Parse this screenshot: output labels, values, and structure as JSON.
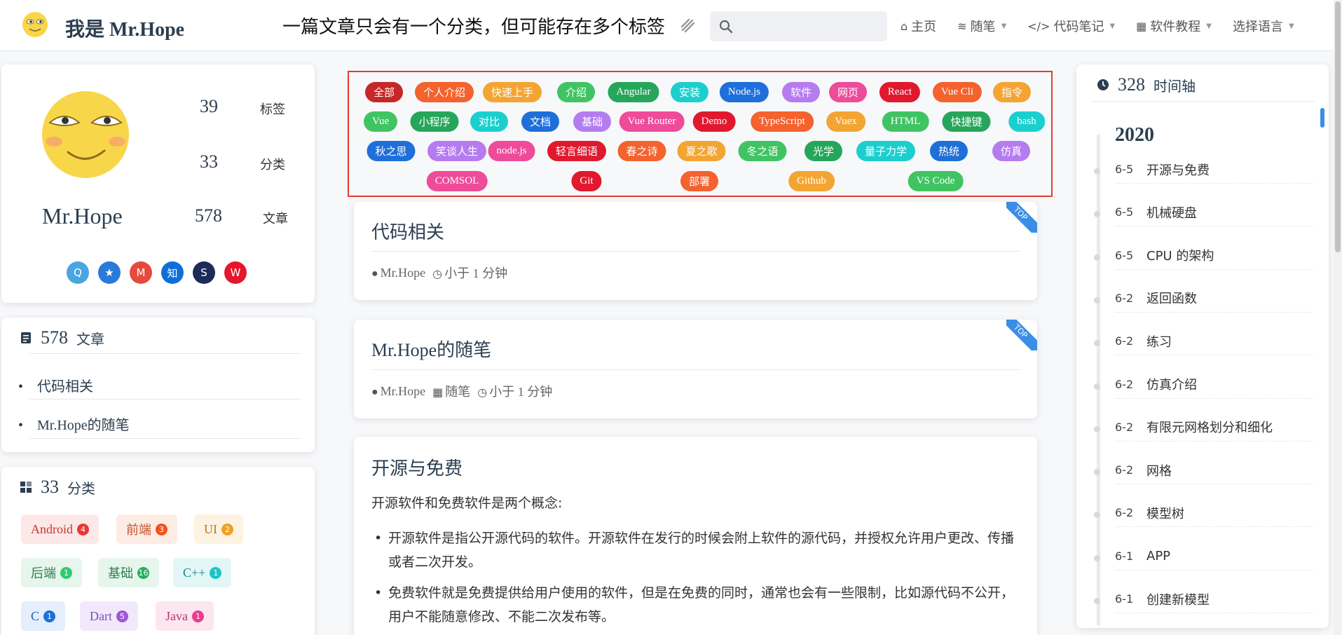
{
  "navbar": {
    "site_title": "我是 Mr.Hope",
    "annotation": "一篇文章只会有一个分类，但可能存在多个标签",
    "search_placeholder": "",
    "items": [
      {
        "icon": "home-icon",
        "glyph": "⌂",
        "label": "主页",
        "dropdown": false
      },
      {
        "icon": "stack-icon",
        "glyph": "≋",
        "label": "随笔",
        "dropdown": true
      },
      {
        "icon": "code-icon",
        "glyph": "</>",
        "label": "代码笔记",
        "dropdown": true
      },
      {
        "icon": "grid-icon",
        "glyph": "▦",
        "label": "软件教程",
        "dropdown": true
      },
      {
        "icon": "",
        "glyph": "",
        "label": "选择语言",
        "dropdown": true
      }
    ]
  },
  "profile": {
    "name": "Mr.Hope",
    "tags_count": "39",
    "tags_label": "标签",
    "cats_count": "33",
    "cats_label": "分类",
    "articles_count": "578",
    "articles_label": "文章",
    "socials": [
      {
        "name": "qq-icon",
        "glyph": "Q",
        "color": "#4aa5e0"
      },
      {
        "name": "qzone-icon",
        "glyph": "★",
        "color": "#2a7ad9"
      },
      {
        "name": "gmail-icon",
        "glyph": "M",
        "color": "#e54b3c"
      },
      {
        "name": "zhihu-icon",
        "glyph": "知",
        "color": "#0f6fd8"
      },
      {
        "name": "steam-icon",
        "glyph": "S",
        "color": "#1b2c5a"
      },
      {
        "name": "weibo-icon",
        "glyph": "W",
        "color": "#e6162d"
      }
    ]
  },
  "article_box": {
    "count": "578",
    "label": "文章",
    "items": [
      "代码相关",
      "Mr.Hope的随笔"
    ]
  },
  "category_box": {
    "count": "33",
    "label": "分类",
    "items": [
      {
        "name": "Android",
        "count": "4",
        "bg": "#fde8e8",
        "fg": "#c0392b",
        "badge": "#e53935"
      },
      {
        "name": "前端",
        "count": "3",
        "bg": "#fdece4",
        "fg": "#c0552b",
        "badge": "#f4511e"
      },
      {
        "name": "UI",
        "count": "2",
        "bg": "#fdf3e2",
        "fg": "#b7791f",
        "badge": "#f0a020"
      },
      {
        "name": "后端",
        "count": "1",
        "bg": "#e6f6ec",
        "fg": "#2e7d4f",
        "badge": "#2ecc71"
      },
      {
        "name": "基础",
        "count": "16",
        "bg": "#e6f6ec",
        "fg": "#2e7d4f",
        "badge": "#27ae60"
      },
      {
        "name": "C++",
        "count": "1",
        "bg": "#e2f6f6",
        "fg": "#178a8a",
        "badge": "#1bc5c5"
      },
      {
        "name": "C",
        "count": "1",
        "bg": "#e4eefc",
        "fg": "#1e5fb8",
        "badge": "#1e6fd9"
      },
      {
        "name": "Dart",
        "count": "5",
        "bg": "#f1e9fb",
        "fg": "#7b4fb5",
        "badge": "#9b59d6"
      },
      {
        "name": "Java",
        "count": "1",
        "bg": "#fce6ef",
        "fg": "#b8336a",
        "badge": "#e83e8c"
      }
    ]
  },
  "tags": [
    {
      "label": "全部",
      "color": "#c62828"
    },
    {
      "label": "个人介绍",
      "color": "#f4622e"
    },
    {
      "label": "快速上手",
      "color": "#f3a533"
    },
    {
      "label": "介绍",
      "color": "#40c463"
    },
    {
      "label": "Angular",
      "color": "#26a65b"
    },
    {
      "label": "安装",
      "color": "#1ccfcf"
    },
    {
      "label": "Node.js",
      "color": "#1e6fd9"
    },
    {
      "label": "软件",
      "color": "#b57cf0"
    },
    {
      "label": "网页",
      "color": "#ef4b9b"
    },
    {
      "label": "React",
      "color": "#e0192f"
    },
    {
      "label": "Vue Cli",
      "color": "#f4622e"
    },
    {
      "label": "指令",
      "color": "#f3a533"
    },
    {
      "label": "Vue",
      "color": "#40c463"
    },
    {
      "label": "小程序",
      "color": "#26a65b"
    },
    {
      "label": "对比",
      "color": "#1ccfcf"
    },
    {
      "label": "文档",
      "color": "#1e6fd9"
    },
    {
      "label": "基础",
      "color": "#b57cf0"
    },
    {
      "label": "Vue Router",
      "color": "#ef4b9b"
    },
    {
      "label": "Demo",
      "color": "#e0192f"
    },
    {
      "label": "TypeScript",
      "color": "#f4622e"
    },
    {
      "label": "Vuex",
      "color": "#f3a533"
    },
    {
      "label": "HTML",
      "color": "#40c463"
    },
    {
      "label": "快捷键",
      "color": "#26a65b"
    },
    {
      "label": "bash",
      "color": "#1ccfcf"
    },
    {
      "label": "秋之思",
      "color": "#1e6fd9"
    },
    {
      "label": "笑谈人生",
      "color": "#b57cf0"
    },
    {
      "label": "node.js",
      "color": "#ef4b9b"
    },
    {
      "label": "轻言细语",
      "color": "#e0192f"
    },
    {
      "label": "春之诗",
      "color": "#f4622e"
    },
    {
      "label": "夏之歌",
      "color": "#f3a533"
    },
    {
      "label": "冬之语",
      "color": "#40c463"
    },
    {
      "label": "光学",
      "color": "#26a65b"
    },
    {
      "label": "量子力学",
      "color": "#1ccfcf"
    },
    {
      "label": "热统",
      "color": "#1e6fd9"
    },
    {
      "label": "仿真",
      "color": "#b57cf0"
    },
    {
      "label": "COMSOL",
      "color": "#ef4b9b"
    },
    {
      "label": "Git",
      "color": "#e0192f"
    },
    {
      "label": "部署",
      "color": "#f4622e"
    },
    {
      "label": "Github",
      "color": "#f3a533"
    },
    {
      "label": "VS Code",
      "color": "#40c463"
    }
  ],
  "tag_annotation": "标签",
  "articles": [
    {
      "title": "代码相关",
      "author": "Mr.Hope",
      "category": "",
      "reading_time": "小于 1 分钟",
      "sticky": "TOP"
    },
    {
      "title": "Mr.Hope的随笔",
      "author": "Mr.Hope",
      "category": "随笔",
      "reading_time": "小于 1 分钟",
      "sticky": "TOP"
    },
    {
      "title": "开源与免费",
      "excerpt_intro": "开源软件和免费软件是两个概念:",
      "bullets": [
        "开源软件是指公开源代码的软件。开源软件在发行的时候会附上软件的源代码，并授权允许用户更改、传播或者二次开发。",
        "免费软件就是免费提供给用户使用的软件，但是在免费的同时，通常也会有一些限制，比如源代码不公开，用户不能随意修改、不能二次发布等。"
      ]
    }
  ],
  "timeline": {
    "count": "328",
    "label": "时间轴",
    "year": "2020",
    "items": [
      {
        "date": "6-5",
        "title": "开源与免费"
      },
      {
        "date": "6-5",
        "title": "机械硬盘"
      },
      {
        "date": "6-5",
        "title": "CPU 的架构"
      },
      {
        "date": "6-2",
        "title": "返回函数"
      },
      {
        "date": "6-2",
        "title": "练习"
      },
      {
        "date": "6-2",
        "title": "仿真介绍"
      },
      {
        "date": "6-2",
        "title": "有限元网格划分和细化"
      },
      {
        "date": "6-2",
        "title": "网格"
      },
      {
        "date": "6-2",
        "title": "模型树"
      },
      {
        "date": "6-1",
        "title": "APP"
      },
      {
        "date": "6-1",
        "title": "创建新模型"
      }
    ]
  }
}
